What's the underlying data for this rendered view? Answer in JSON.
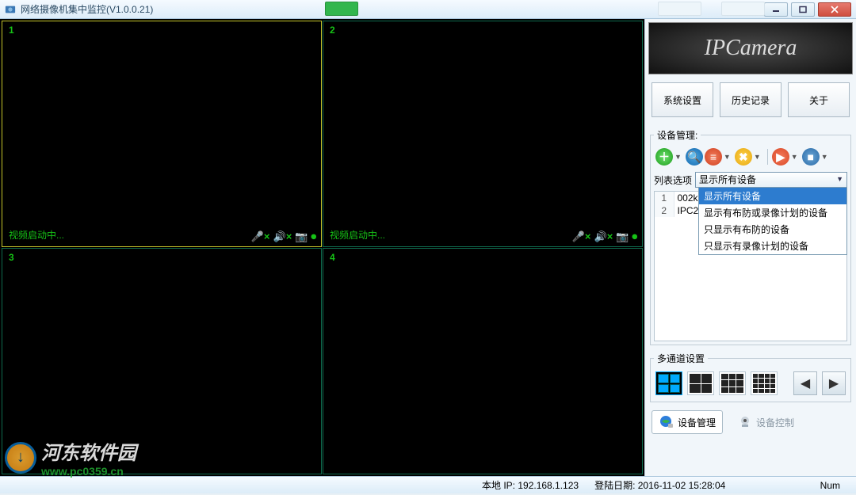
{
  "title": "网络摄像机集中监控(V1.0.0.21)",
  "brand": "IPCamera",
  "buttons": {
    "sys": "系统设置",
    "hist": "历史记录",
    "about": "关于"
  },
  "deviceMgmt": "设备管理:",
  "listOption": {
    "label": "列表选项",
    "selected": "显示所有设备"
  },
  "dropdown": [
    "显示所有设备",
    "显示有布防或录像计划的设备",
    "只显示有布防的设备",
    "只显示有录像计划的设备"
  ],
  "devices": [
    {
      "idx": "1",
      "name": "002k"
    },
    {
      "idx": "2",
      "name": "IPC2"
    }
  ],
  "multiChannel": "多通道设置",
  "tabs": {
    "devmgmt": "设备管理",
    "devctrl": "设备控制"
  },
  "cells": [
    {
      "n": "1",
      "status": "视频启动中..."
    },
    {
      "n": "2",
      "status": "视频启动中..."
    },
    {
      "n": "3",
      "status": ""
    },
    {
      "n": "4",
      "status": ""
    }
  ],
  "status": {
    "ip": "本地 IP: 192.168.1.123",
    "login": "登陆日期: 2016-11-02 15:28:04",
    "num": "Num"
  },
  "watermark": {
    "name": "河东软件园",
    "url": "www.pc0359.cn"
  }
}
